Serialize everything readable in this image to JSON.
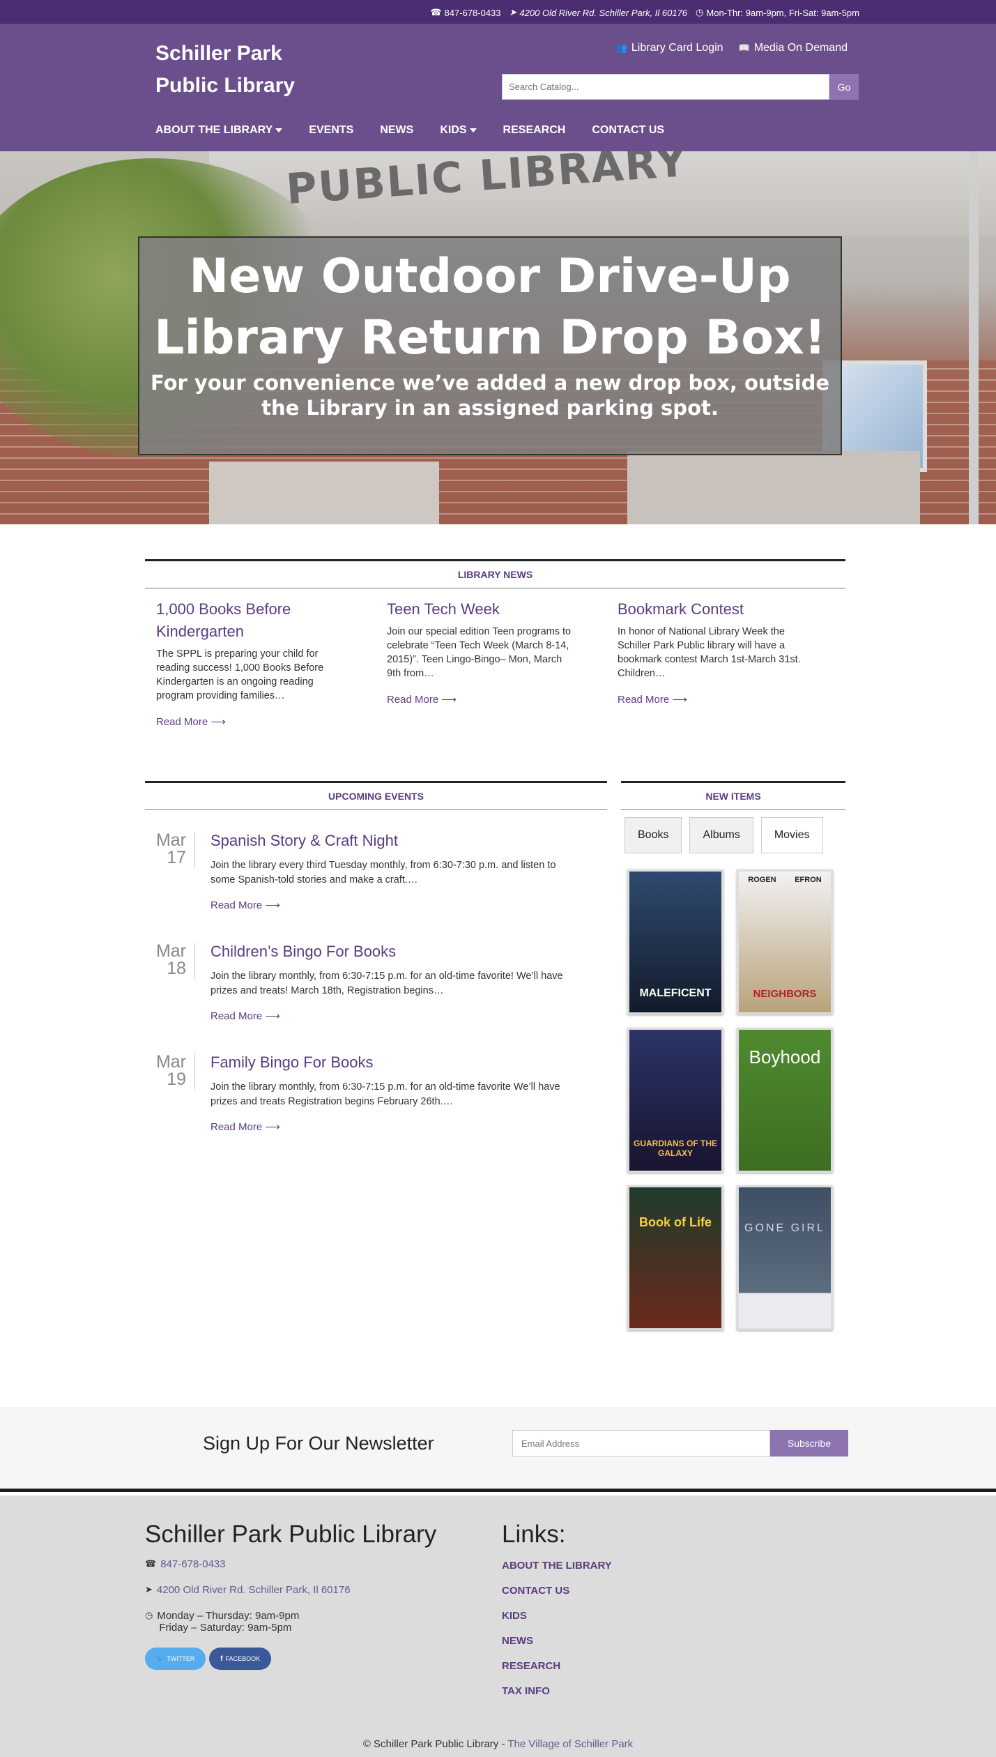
{
  "topbar": {
    "phone": "847-678-0433",
    "address": "4200 Old River Rd. Schiller Park, Il 60176",
    "hours": "Mon-Thr: 9am-9pm, Fri-Sat: 9am-5pm"
  },
  "header": {
    "title_line1": "Schiller Park",
    "title_line2": "Public Library",
    "library_card_login": "Library Card Login",
    "media_on_demand": "Media On Demand",
    "search_placeholder": "Search Catalog...",
    "search_button": "Go"
  },
  "nav": {
    "about": "ABOUT THE LIBRARY",
    "events": "EVENTS",
    "news": "NEWS",
    "kids": "KIDS",
    "research": "RESEARCH",
    "contact": "CONTACT US"
  },
  "hero": {
    "building_sign": "PUBLIC LIBRARY",
    "headline": "New Outdoor Drive-Up Library Return Drop Box!",
    "subtext": "For your convenience we’ve added a new drop box, outside the Library in an assigned parking spot."
  },
  "library_news": {
    "heading": "LIBRARY NEWS",
    "items": [
      {
        "title": "1,000 Books Before Kindergarten",
        "excerpt": "The SPPL is preparing your child for reading success! 1,000 Books Before Kindergarten is an ongoing reading program providing families…",
        "read_more": "Read More ⟶"
      },
      {
        "title": "Teen Tech Week",
        "excerpt": "Join our special edition Teen programs to celebrate “Teen Tech Week (March 8-14, 2015)”. Teen Lingo-Bingo– Mon, March 9th from…",
        "read_more": "Read More ⟶"
      },
      {
        "title": "Bookmark Contest",
        "excerpt": "In honor of National Library Week the Schiller Park Public library will have a bookmark contest March 1st-March 31st. Children…",
        "read_more": "Read More ⟶"
      }
    ]
  },
  "events": {
    "heading": "UPCOMING EVENTS",
    "items": [
      {
        "month": "Mar",
        "day": "17",
        "title": "Spanish Story & Craft Night",
        "excerpt": "Join the library every third Tuesday monthly, from 6:30-7:30 p.m. and listen to some Spanish-told stories and make a craft.…",
        "read_more": "Read More ⟶"
      },
      {
        "month": "Mar",
        "day": "18",
        "title": "Children’s Bingo For Books",
        "excerpt": "Join the library monthly, from 6:30-7:15 p.m. for an old-time favorite! We’ll have prizes and treats! March 18th, Registration begins…",
        "read_more": "Read More ⟶"
      },
      {
        "month": "Mar",
        "day": "19",
        "title": "Family Bingo For Books",
        "excerpt": "Join the library monthly, from 6:30-7:15 p.m. for an old-time favorite We’ll have prizes and treats Registration begins February 26th.…",
        "read_more": "Read More ⟶"
      }
    ]
  },
  "new_items": {
    "heading": "NEW ITEMS",
    "tabs": [
      "Books",
      "Albums",
      "Movies"
    ],
    "active_tab": "Movies",
    "posters": [
      {
        "title": "MALEFICENT",
        "color_top": "#2f4a6e",
        "color_bottom": "#121b2b"
      },
      {
        "title": "NEIGHBORS",
        "names": [
          "ROGEN",
          "EFRON"
        ],
        "color_top": "#f2f2f2",
        "color_bottom": "#b8a27a"
      },
      {
        "title": "GUARDIANS OF THE GALAXY",
        "color_top": "#2a3466",
        "color_bottom": "#1a1430"
      },
      {
        "title": "Boyhood",
        "color_top": "#4f8a2f",
        "color_bottom": "#3d6e22"
      },
      {
        "title": "Book of Life",
        "color_top": "#1f3b2c",
        "color_bottom": "#6b2a1c"
      },
      {
        "title": "GONE GIRL",
        "color_top": "#3e4f63",
        "color_bottom": "#e9ebee"
      }
    ]
  },
  "newsletter": {
    "heading": "Sign Up For Our Newsletter",
    "email_placeholder": "Email Address",
    "subscribe": "Subscribe"
  },
  "footer": {
    "library_name": "Schiller Park Public Library",
    "phone": "847-678-0433",
    "address": "4200 Old River Rd. Schiller Park, Il 60176",
    "hours_line1": "Monday – Thursday: 9am-9pm",
    "hours_line2": "Friday – Saturday: 9am-5pm",
    "twitter": "TWITTER",
    "facebook": "FACEBOOK",
    "links_heading": "Links:",
    "links": [
      "ABOUT THE LIBRARY",
      "CONTACT US",
      "KIDS",
      "NEWS",
      "RESEARCH",
      "TAX INFO"
    ],
    "copyright_prefix": "© Schiller Park Public Library -",
    "village_link": "The Village of Schiller Park"
  },
  "colors": {
    "topbar": "#4b2d71",
    "header": "#6a4f8c",
    "accent": "#5a3c82",
    "button": "#8d74b1",
    "twitter": "#55acee",
    "facebook": "#3b5998"
  }
}
